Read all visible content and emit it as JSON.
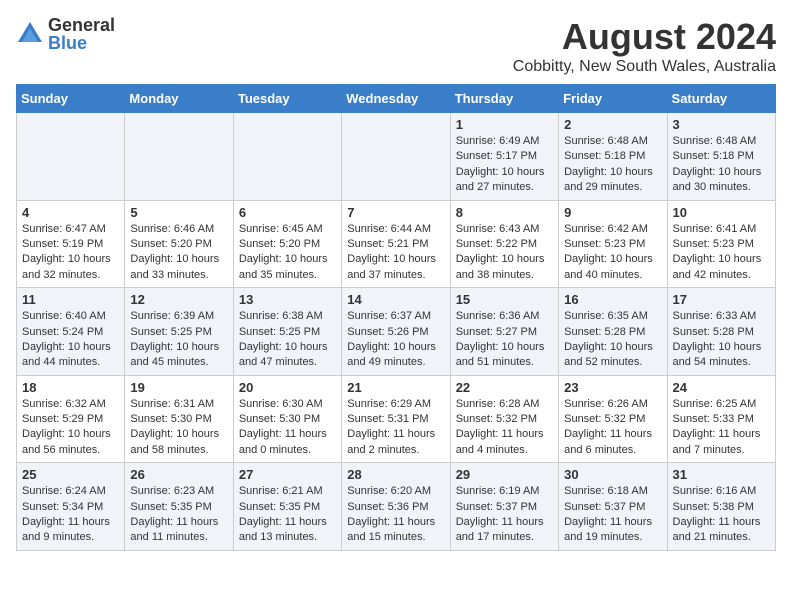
{
  "logo": {
    "general": "General",
    "blue": "Blue"
  },
  "title": "August 2024",
  "subtitle": "Cobbitty, New South Wales, Australia",
  "headers": [
    "Sunday",
    "Monday",
    "Tuesday",
    "Wednesday",
    "Thursday",
    "Friday",
    "Saturday"
  ],
  "weeks": [
    [
      {
        "day": "",
        "content": ""
      },
      {
        "day": "",
        "content": ""
      },
      {
        "day": "",
        "content": ""
      },
      {
        "day": "",
        "content": ""
      },
      {
        "day": "1",
        "content": "Sunrise: 6:49 AM\nSunset: 5:17 PM\nDaylight: 10 hours\nand 27 minutes."
      },
      {
        "day": "2",
        "content": "Sunrise: 6:48 AM\nSunset: 5:18 PM\nDaylight: 10 hours\nand 29 minutes."
      },
      {
        "day": "3",
        "content": "Sunrise: 6:48 AM\nSunset: 5:18 PM\nDaylight: 10 hours\nand 30 minutes."
      }
    ],
    [
      {
        "day": "4",
        "content": "Sunrise: 6:47 AM\nSunset: 5:19 PM\nDaylight: 10 hours\nand 32 minutes."
      },
      {
        "day": "5",
        "content": "Sunrise: 6:46 AM\nSunset: 5:20 PM\nDaylight: 10 hours\nand 33 minutes."
      },
      {
        "day": "6",
        "content": "Sunrise: 6:45 AM\nSunset: 5:20 PM\nDaylight: 10 hours\nand 35 minutes."
      },
      {
        "day": "7",
        "content": "Sunrise: 6:44 AM\nSunset: 5:21 PM\nDaylight: 10 hours\nand 37 minutes."
      },
      {
        "day": "8",
        "content": "Sunrise: 6:43 AM\nSunset: 5:22 PM\nDaylight: 10 hours\nand 38 minutes."
      },
      {
        "day": "9",
        "content": "Sunrise: 6:42 AM\nSunset: 5:23 PM\nDaylight: 10 hours\nand 40 minutes."
      },
      {
        "day": "10",
        "content": "Sunrise: 6:41 AM\nSunset: 5:23 PM\nDaylight: 10 hours\nand 42 minutes."
      }
    ],
    [
      {
        "day": "11",
        "content": "Sunrise: 6:40 AM\nSunset: 5:24 PM\nDaylight: 10 hours\nand 44 minutes."
      },
      {
        "day": "12",
        "content": "Sunrise: 6:39 AM\nSunset: 5:25 PM\nDaylight: 10 hours\nand 45 minutes."
      },
      {
        "day": "13",
        "content": "Sunrise: 6:38 AM\nSunset: 5:25 PM\nDaylight: 10 hours\nand 47 minutes."
      },
      {
        "day": "14",
        "content": "Sunrise: 6:37 AM\nSunset: 5:26 PM\nDaylight: 10 hours\nand 49 minutes."
      },
      {
        "day": "15",
        "content": "Sunrise: 6:36 AM\nSunset: 5:27 PM\nDaylight: 10 hours\nand 51 minutes."
      },
      {
        "day": "16",
        "content": "Sunrise: 6:35 AM\nSunset: 5:28 PM\nDaylight: 10 hours\nand 52 minutes."
      },
      {
        "day": "17",
        "content": "Sunrise: 6:33 AM\nSunset: 5:28 PM\nDaylight: 10 hours\nand 54 minutes."
      }
    ],
    [
      {
        "day": "18",
        "content": "Sunrise: 6:32 AM\nSunset: 5:29 PM\nDaylight: 10 hours\nand 56 minutes."
      },
      {
        "day": "19",
        "content": "Sunrise: 6:31 AM\nSunset: 5:30 PM\nDaylight: 10 hours\nand 58 minutes."
      },
      {
        "day": "20",
        "content": "Sunrise: 6:30 AM\nSunset: 5:30 PM\nDaylight: 11 hours\nand 0 minutes."
      },
      {
        "day": "21",
        "content": "Sunrise: 6:29 AM\nSunset: 5:31 PM\nDaylight: 11 hours\nand 2 minutes."
      },
      {
        "day": "22",
        "content": "Sunrise: 6:28 AM\nSunset: 5:32 PM\nDaylight: 11 hours\nand 4 minutes."
      },
      {
        "day": "23",
        "content": "Sunrise: 6:26 AM\nSunset: 5:32 PM\nDaylight: 11 hours\nand 6 minutes."
      },
      {
        "day": "24",
        "content": "Sunrise: 6:25 AM\nSunset: 5:33 PM\nDaylight: 11 hours\nand 7 minutes."
      }
    ],
    [
      {
        "day": "25",
        "content": "Sunrise: 6:24 AM\nSunset: 5:34 PM\nDaylight: 11 hours\nand 9 minutes."
      },
      {
        "day": "26",
        "content": "Sunrise: 6:23 AM\nSunset: 5:35 PM\nDaylight: 11 hours\nand 11 minutes."
      },
      {
        "day": "27",
        "content": "Sunrise: 6:21 AM\nSunset: 5:35 PM\nDaylight: 11 hours\nand 13 minutes."
      },
      {
        "day": "28",
        "content": "Sunrise: 6:20 AM\nSunset: 5:36 PM\nDaylight: 11 hours\nand 15 minutes."
      },
      {
        "day": "29",
        "content": "Sunrise: 6:19 AM\nSunset: 5:37 PM\nDaylight: 11 hours\nand 17 minutes."
      },
      {
        "day": "30",
        "content": "Sunrise: 6:18 AM\nSunset: 5:37 PM\nDaylight: 11 hours\nand 19 minutes."
      },
      {
        "day": "31",
        "content": "Sunrise: 6:16 AM\nSunset: 5:38 PM\nDaylight: 11 hours\nand 21 minutes."
      }
    ]
  ]
}
